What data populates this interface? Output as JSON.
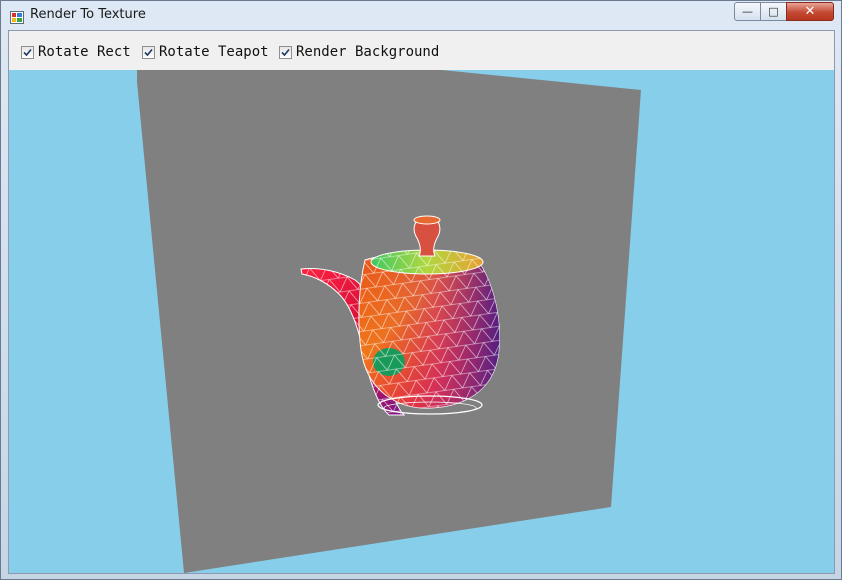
{
  "window": {
    "title": "Render To Texture",
    "minimize_glyph": "—",
    "maximize_glyph": "□",
    "close_glyph": "✕"
  },
  "toolbar": {
    "checkboxes": [
      {
        "label": "Rotate Rect",
        "checked": true
      },
      {
        "label": "Rotate Teapot",
        "checked": true
      },
      {
        "label": "Render Background",
        "checked": true
      }
    ]
  },
  "viewport": {
    "background_color": "#87ceeb",
    "rect_color": "#808080",
    "mesh_color": "#ffffff"
  }
}
